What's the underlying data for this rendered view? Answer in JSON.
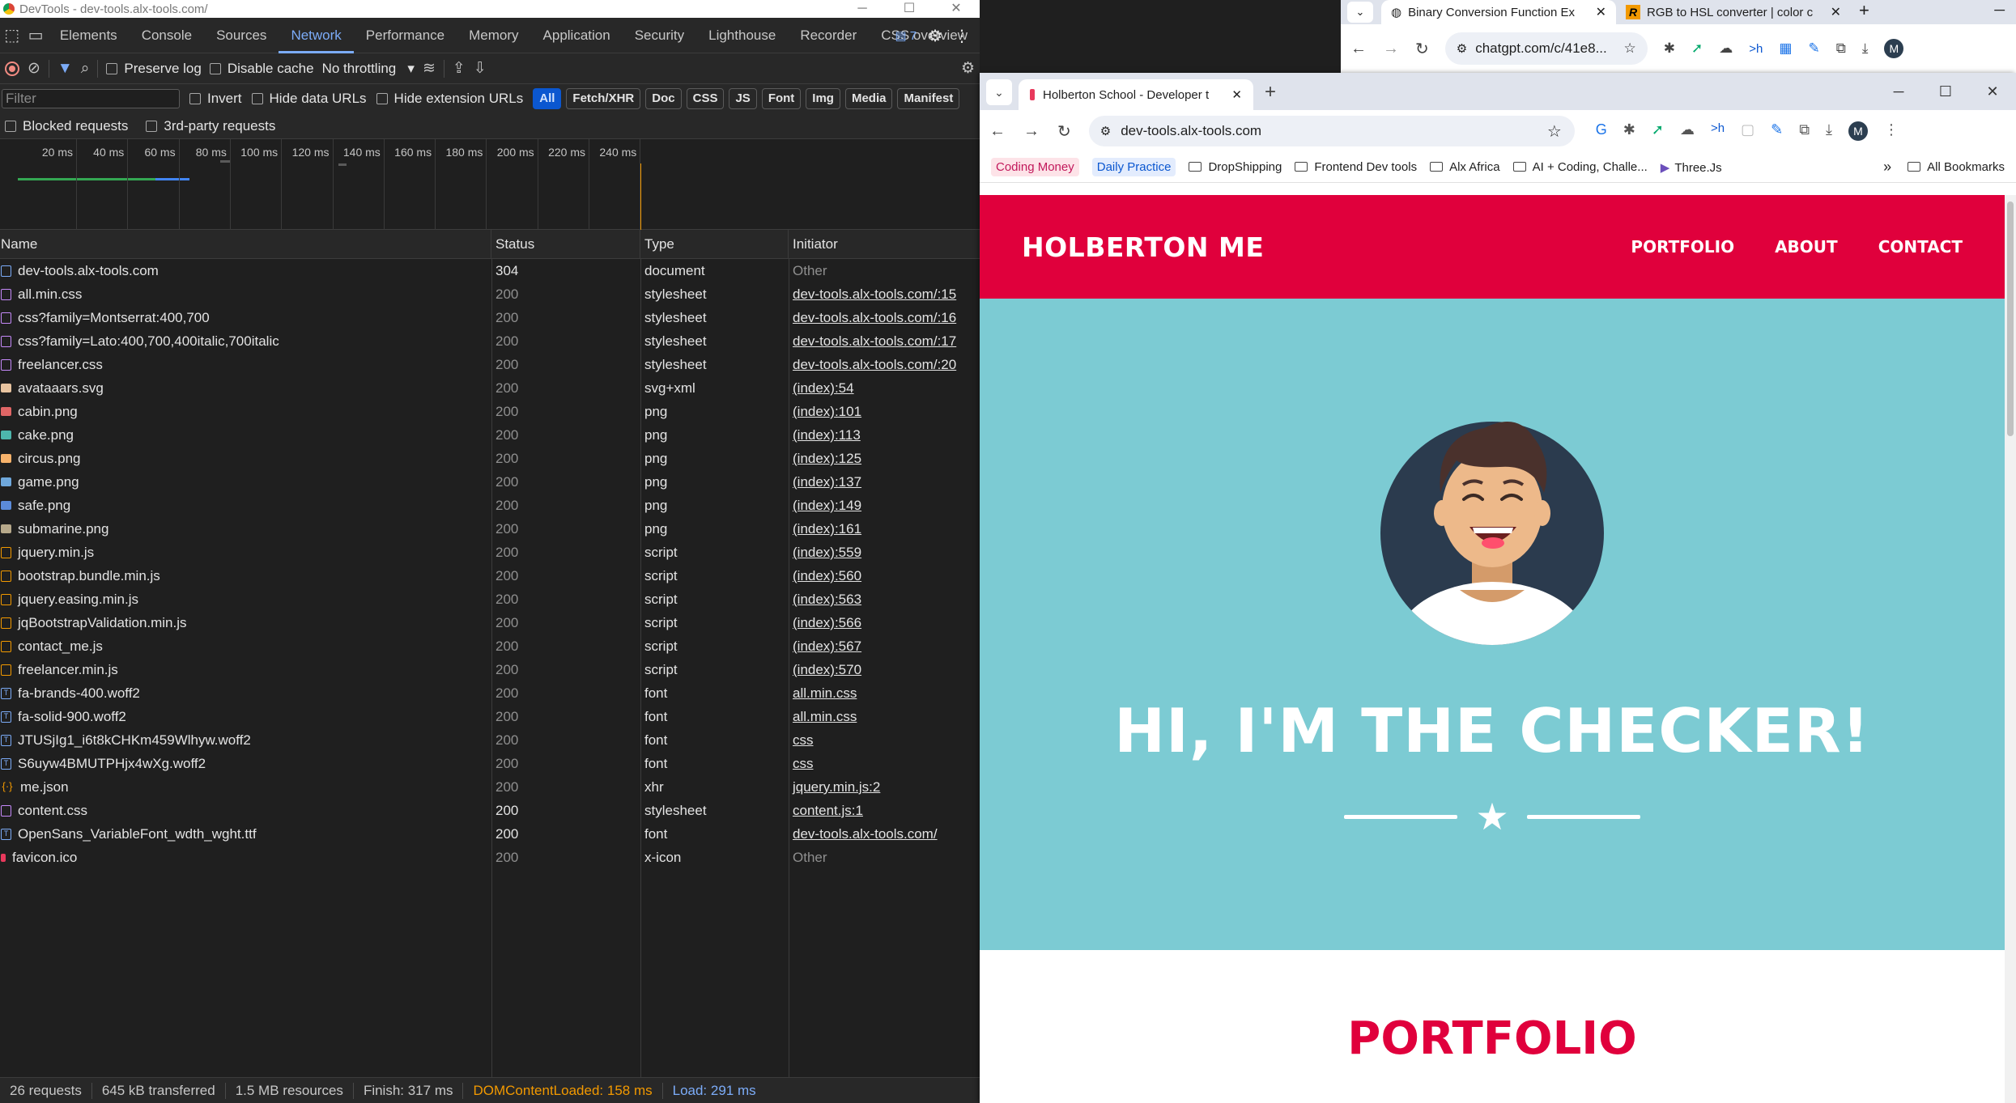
{
  "devtools": {
    "window_title": "DevTools - dev-tools.alx-tools.com/",
    "tabs": [
      "Elements",
      "Console",
      "Sources",
      "Network",
      "Performance",
      "Memory",
      "Application",
      "Security",
      "Lighthouse",
      "Recorder",
      "CSS overview"
    ],
    "active_tab": "Network",
    "issues_count": "7",
    "toolbar": {
      "preserve_log": "Preserve log",
      "disable_cache": "Disable cache",
      "throttling": "No throttling"
    },
    "filter": {
      "placeholder": "Filter",
      "invert": "Invert",
      "hide_data_urls": "Hide data URLs",
      "hide_extension_urls": "Hide extension URLs",
      "types": [
        "All",
        "Fetch/XHR",
        "Doc",
        "CSS",
        "JS",
        "Font",
        "Img",
        "Media",
        "Manifest"
      ],
      "active_type": "All"
    },
    "blocked_requests": "Blocked requests",
    "third_party_requests": "3rd-party requests",
    "timeline_ticks": [
      "20 ms",
      "40 ms",
      "60 ms",
      "80 ms",
      "100 ms",
      "120 ms",
      "140 ms",
      "160 ms",
      "180 ms",
      "200 ms",
      "220 ms",
      "240 ms"
    ],
    "columns": {
      "name": "Name",
      "status": "Status",
      "type": "Type",
      "initiator": "Initiator"
    },
    "requests": [
      {
        "name": "dev-tools.alx-tools.com",
        "status": "304",
        "type": "document",
        "initiator": "Other",
        "icon": "doc-icon"
      },
      {
        "name": "all.min.css",
        "status": "200",
        "type": "stylesheet",
        "initiator": "dev-tools.alx-tools.com/:15",
        "icon": "css-icon"
      },
      {
        "name": "css?family=Montserrat:400,700",
        "status": "200",
        "type": "stylesheet",
        "initiator": "dev-tools.alx-tools.com/:16",
        "icon": "css-icon"
      },
      {
        "name": "css?family=Lato:400,700,400italic,700italic",
        "status": "200",
        "type": "stylesheet",
        "initiator": "dev-tools.alx-tools.com/:17",
        "icon": "css-icon"
      },
      {
        "name": "freelancer.css",
        "status": "200",
        "type": "stylesheet",
        "initiator": "dev-tools.alx-tools.com/:20",
        "icon": "css-icon"
      },
      {
        "name": "avataaars.svg",
        "status": "200",
        "type": "svg+xml",
        "initiator": "(index):54",
        "icon": "avatar-image-icon"
      },
      {
        "name": "cabin.png",
        "status": "200",
        "type": "png",
        "initiator": "(index):101",
        "icon": "cabin-image-icon"
      },
      {
        "name": "cake.png",
        "status": "200",
        "type": "png",
        "initiator": "(index):113",
        "icon": "cake-image-icon"
      },
      {
        "name": "circus.png",
        "status": "200",
        "type": "png",
        "initiator": "(index):125",
        "icon": "circus-image-icon"
      },
      {
        "name": "game.png",
        "status": "200",
        "type": "png",
        "initiator": "(index):137",
        "icon": "game-image-icon"
      },
      {
        "name": "safe.png",
        "status": "200",
        "type": "png",
        "initiator": "(index):149",
        "icon": "safe-image-icon"
      },
      {
        "name": "submarine.png",
        "status": "200",
        "type": "png",
        "initiator": "(index):161",
        "icon": "submarine-image-icon"
      },
      {
        "name": "jquery.min.js",
        "status": "200",
        "type": "script",
        "initiator": "(index):559",
        "icon": "js-icon"
      },
      {
        "name": "bootstrap.bundle.min.js",
        "status": "200",
        "type": "script",
        "initiator": "(index):560",
        "icon": "js-icon"
      },
      {
        "name": "jquery.easing.min.js",
        "status": "200",
        "type": "script",
        "initiator": "(index):563",
        "icon": "js-icon"
      },
      {
        "name": "jqBootstrapValidation.min.js",
        "status": "200",
        "type": "script",
        "initiator": "(index):566",
        "icon": "js-icon"
      },
      {
        "name": "contact_me.js",
        "status": "200",
        "type": "script",
        "initiator": "(index):567",
        "icon": "js-icon"
      },
      {
        "name": "freelancer.min.js",
        "status": "200",
        "type": "script",
        "initiator": "(index):570",
        "icon": "js-icon"
      },
      {
        "name": "fa-brands-400.woff2",
        "status": "200",
        "type": "font",
        "initiator": "all.min.css",
        "icon": "font-icon"
      },
      {
        "name": "fa-solid-900.woff2",
        "status": "200",
        "type": "font",
        "initiator": "all.min.css",
        "icon": "font-icon"
      },
      {
        "name": "JTUSjIg1_i6t8kCHKm459Wlhyw.woff2",
        "status": "200",
        "type": "font",
        "initiator": "css",
        "icon": "font-icon"
      },
      {
        "name": "S6uyw4BMUTPHjx4wXg.woff2",
        "status": "200",
        "type": "font",
        "initiator": "css",
        "icon": "font-icon"
      },
      {
        "name": "me.json",
        "status": "200",
        "type": "xhr",
        "initiator": "jquery.min.js:2",
        "icon": "xhr-icon"
      },
      {
        "name": "content.css",
        "status": "200",
        "type": "stylesheet",
        "initiator": "content.js:1",
        "icon": "css-icon"
      },
      {
        "name": "OpenSans_VariableFont_wdth_wght.ttf",
        "status": "200",
        "type": "font",
        "initiator": "dev-tools.alx-tools.com/",
        "icon": "font-icon"
      },
      {
        "name": "favicon.ico",
        "status": "200",
        "type": "x-icon",
        "initiator": "Other",
        "icon": "favicon-icon"
      }
    ],
    "statusbar": {
      "requests": "26 requests",
      "transferred": "645 kB transferred",
      "resources": "1.5 MB resources",
      "finish": "Finish: 317 ms",
      "dom_content_loaded": "DOMContentLoaded: 158 ms",
      "load": "Load: 291 ms"
    }
  },
  "back_browser": {
    "tabs": [
      {
        "title": "Binary Conversion Function Ex",
        "active": true
      },
      {
        "title": "RGB to HSL converter | color c",
        "active": false
      }
    ],
    "url": "chatgpt.com/c/41e8..."
  },
  "front_browser": {
    "tab_title": "Holberton School - Developer t",
    "url": "dev-tools.alx-tools.com",
    "avatar_initial": "M",
    "bookmarks": [
      "Coding Money",
      "Daily Practice",
      "DropShipping",
      "Frontend Dev tools",
      "Alx Africa",
      "AI + Coding, Challe...",
      "Three.Js"
    ],
    "all_bookmarks": "All Bookmarks"
  },
  "webpage": {
    "brand": "HOLBERTON ME",
    "nav": [
      "PORTFOLIO",
      "ABOUT",
      "CONTACT"
    ],
    "hero_title": "HI, I'M THE CHECKER!",
    "portfolio_heading": "PORTFOLIO",
    "colors": {
      "primary": "#e0003c",
      "masthead": "#7ccbd3"
    }
  }
}
